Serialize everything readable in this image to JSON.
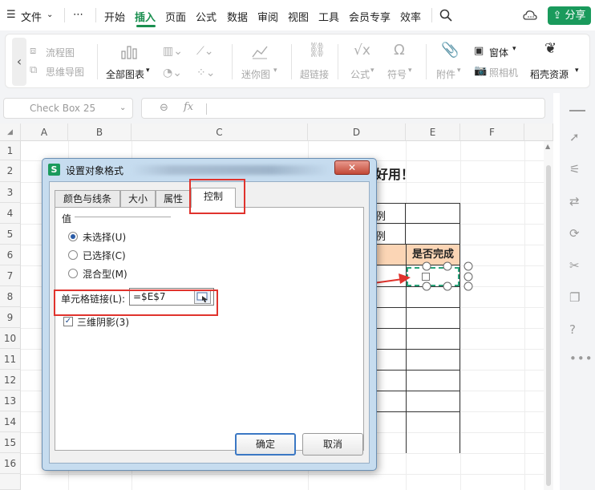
{
  "menubar": {
    "hamburger": "☰",
    "file_label": "文件",
    "more": "⋯",
    "items": [
      "开始",
      "插入",
      "页面",
      "公式",
      "数据",
      "审阅",
      "视图",
      "工具",
      "会员专享",
      "效率"
    ],
    "active_item": "插入",
    "share_label": "分享"
  },
  "ribbon": {
    "flowchart": "流程图",
    "mindmap": "思维导图",
    "all_charts": "全部图表",
    "sparkline": "迷你图",
    "hyperlink": "超链接",
    "formula": "公式",
    "symbol": "符号",
    "attachment": "附件",
    "window": "窗体",
    "camera": "照相机",
    "resources": "稻壳资源"
  },
  "formulabar": {
    "namebox_value": "Check Box 25",
    "fx": "fx"
  },
  "grid": {
    "columns": [
      "A",
      "B",
      "C",
      "D",
      "E",
      "F"
    ],
    "rows": [
      "1",
      "2",
      "3",
      "4",
      "5",
      "6",
      "7",
      "8",
      "9",
      "10",
      "11",
      "12",
      "13",
      "14",
      "15",
      "16"
    ],
    "title_visible": "又好用！",
    "d4": "例",
    "d5": "例",
    "e6_header": "是否完成"
  },
  "dialog": {
    "title": "设置对象格式",
    "tabs": [
      "颜色与线条",
      "大小",
      "属性",
      "控制"
    ],
    "selected_tab": "控制",
    "value_label": "值",
    "radio_options": [
      "未选择(U)",
      "已选择(C)",
      "混合型(M)"
    ],
    "selected_radio": "未选择(U)",
    "cell_link_label": "单元格链接(L):",
    "cell_link_value": "=$E$7",
    "shade_label": "三维阴影(3)",
    "shade_checked": true,
    "ok_label": "确定",
    "cancel_label": "取消"
  },
  "colors": {
    "accent_green": "#1a8f4f",
    "annotation_red": "#e0332d",
    "header_fill": "#fbd5b5"
  }
}
